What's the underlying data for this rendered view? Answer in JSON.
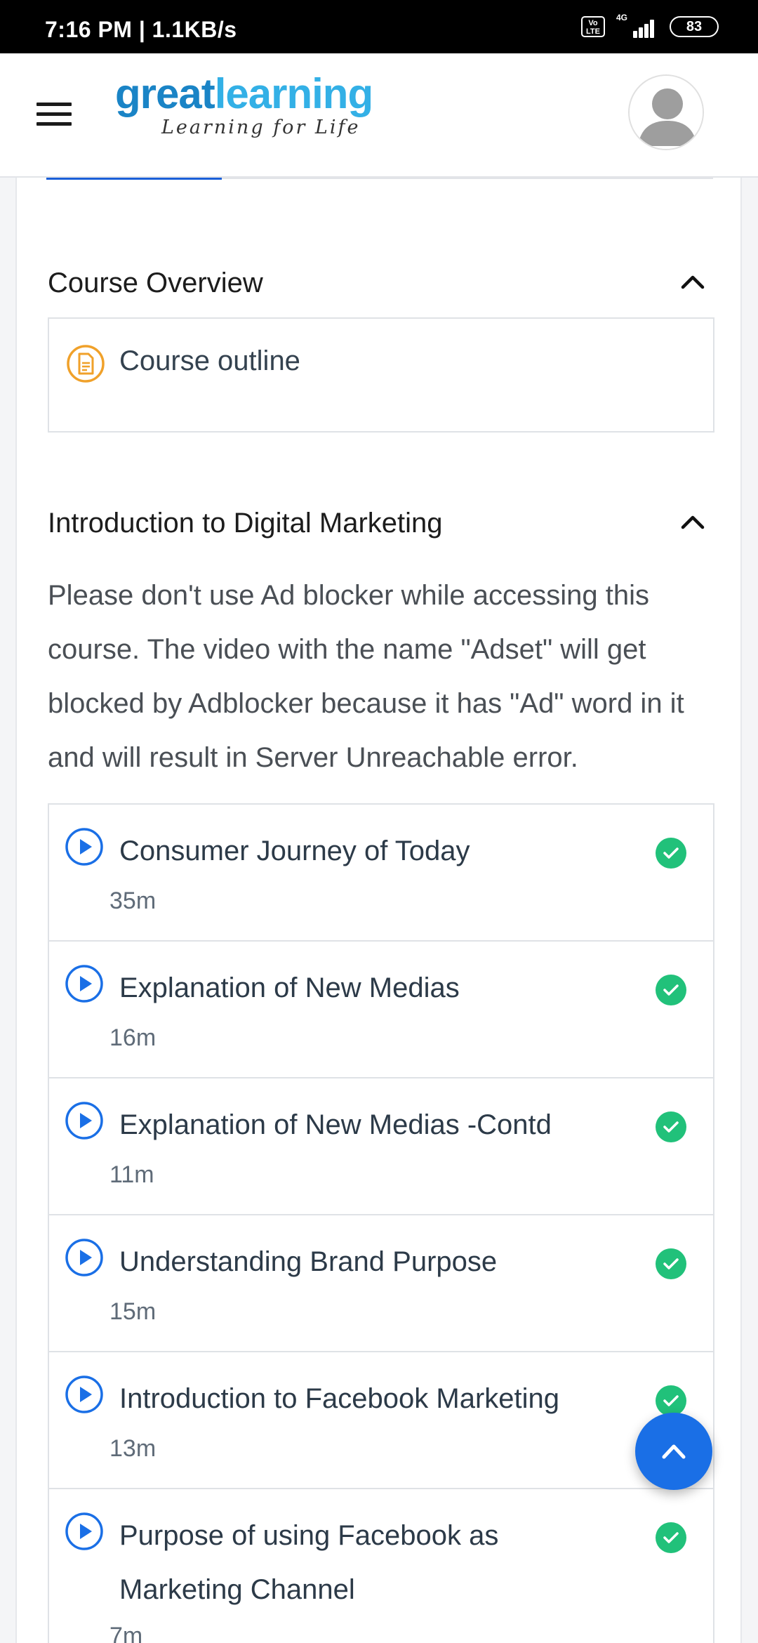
{
  "status_bar": {
    "time": "7:16 PM | 1.1KB/s",
    "volte": "Vo LTE",
    "network": "4G",
    "battery": "83"
  },
  "header": {
    "logo_part1": "great",
    "logo_part2": "learning",
    "tagline": "Learning for Life"
  },
  "sections": [
    {
      "title": "Course Overview",
      "items": [
        {
          "label": "Course outline",
          "icon": "document-icon"
        }
      ]
    },
    {
      "title": "Introduction to Digital Marketing",
      "notice": "Please don't use Ad blocker while accessing this course. The video with the name \"Adset\" will get blocked by Adblocker because it has \"Ad\" word in it and will result in Server Unreachable error.",
      "lessons": [
        {
          "title": "Consumer Journey of Today",
          "duration": "35m",
          "completed": true
        },
        {
          "title": "Explanation of New Medias",
          "duration": "16m",
          "completed": true
        },
        {
          "title": "Explanation of New Medias -Contd",
          "duration": "11m",
          "completed": true
        },
        {
          "title": "Understanding Brand Purpose",
          "duration": "15m",
          "completed": true
        },
        {
          "title": "Introduction to Facebook Marketing",
          "duration": "13m",
          "completed": true
        },
        {
          "title": "Purpose of using Facebook as Marketing Channel",
          "duration": "7m",
          "completed": true
        }
      ]
    }
  ],
  "colors": {
    "accent": "#1a6fe6",
    "check": "#21c17a",
    "outline_icon": "#f0a12a",
    "logo_dark": "#1a84c6",
    "logo_light": "#33b0e6"
  }
}
